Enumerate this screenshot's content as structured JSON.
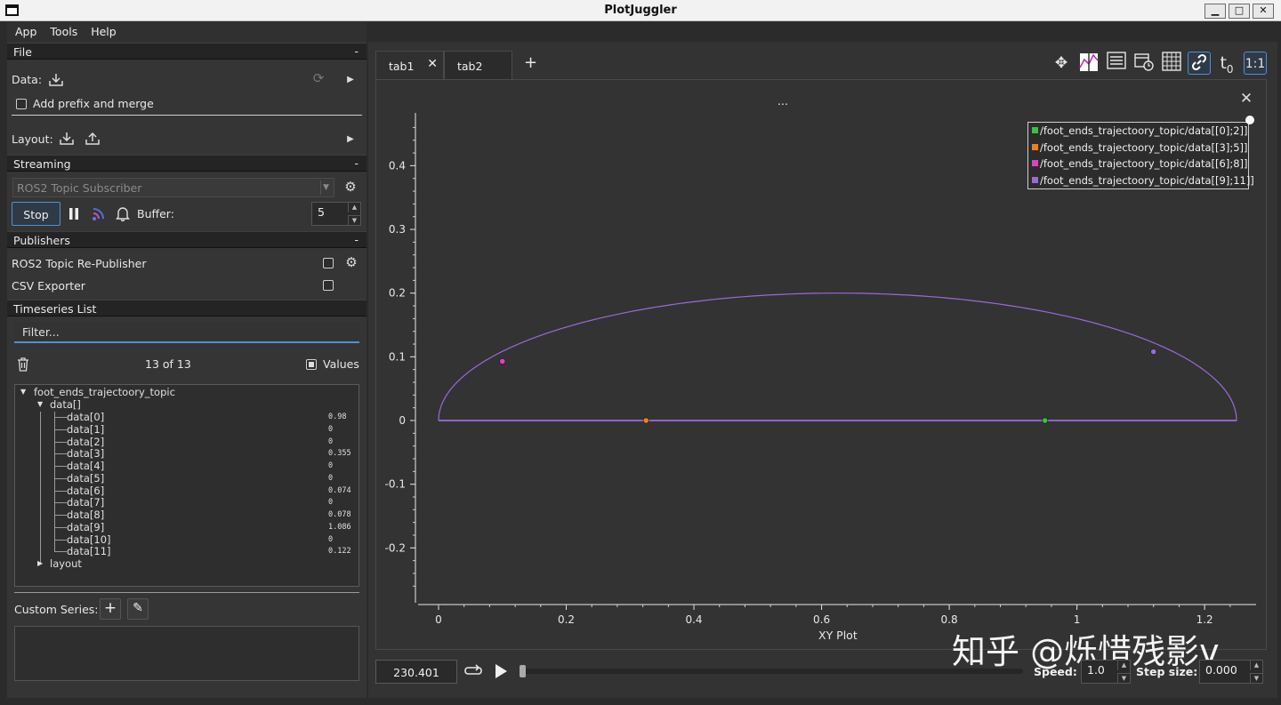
{
  "window": {
    "title": "PlotJuggler",
    "minimize": "▁",
    "maximize": "□",
    "close": "✕"
  },
  "menu": [
    "App",
    "Tools",
    "Help"
  ],
  "file_section": {
    "header": "File",
    "collapse": "-",
    "data_label": "Data:",
    "prefix_merge_label": "Add prefix and merge",
    "layout_label": "Layout:"
  },
  "streaming": {
    "header": "Streaming",
    "collapse": "-",
    "source": "ROS2 Topic Subscriber",
    "stop_label": "Stop",
    "buffer_label": "Buffer:",
    "buffer_value": "5"
  },
  "publishers": {
    "header": "Publishers",
    "collapse": "-",
    "items": [
      {
        "label": "ROS2 Topic Re-Publisher",
        "checked": false
      },
      {
        "label": "CSV Exporter",
        "checked": false
      }
    ]
  },
  "timeseries": {
    "header": "Timeseries List",
    "filter_placeholder": "Filter...",
    "count": "13 of 13",
    "values_label": "Values",
    "tree": {
      "root": "foot_ends_trajectoory_topic",
      "group": "data[]",
      "items": [
        {
          "name": "data[0]",
          "value": "0.98"
        },
        {
          "name": "data[1]",
          "value": "0"
        },
        {
          "name": "data[2]",
          "value": "0"
        },
        {
          "name": "data[3]",
          "value": "0.355"
        },
        {
          "name": "data[4]",
          "value": "0"
        },
        {
          "name": "data[5]",
          "value": "0"
        },
        {
          "name": "data[6]",
          "value": "0.074"
        },
        {
          "name": "data[7]",
          "value": "0"
        },
        {
          "name": "data[8]",
          "value": "0.078"
        },
        {
          "name": "data[9]",
          "value": "1.086"
        },
        {
          "name": "data[10]",
          "value": "0"
        },
        {
          "name": "data[11]",
          "value": "0.122"
        }
      ],
      "layout": "layout"
    }
  },
  "custom_series_label": "Custom Series:",
  "tabs": [
    {
      "label": "tab1",
      "active": true
    },
    {
      "label": "tab2",
      "active": false
    }
  ],
  "add_tab": "+",
  "plot": {
    "top_label": "...",
    "xlabel": "XY Plot",
    "legend": [
      {
        "label": "/foot_ends_trajectoory_topic/data[[0];2]]",
        "color": "#3ec13e"
      },
      {
        "label": "/foot_ends_trajectoory_topic/data[[3];5]]",
        "color": "#f07f1a"
      },
      {
        "label": "/foot_ends_trajectoory_topic/data[[6];8]]",
        "color": "#e040c8"
      },
      {
        "label": "/foot_ends_trajectoory_topic/data[[9];11]]",
        "color": "#9a6ad8"
      }
    ],
    "x_ticks": [
      "0",
      "0.2",
      "0.4",
      "0.6",
      "0.8",
      "1",
      "1.2"
    ],
    "y_ticks": [
      "0.4",
      "0.3",
      "0.2",
      "0.1",
      "0",
      "-0.1",
      "-0.2"
    ],
    "curve_color": "#9a6ad8"
  },
  "chart_data": {
    "type": "line",
    "xlabel": "XY Plot",
    "xlim": [
      -0.03,
      1.28
    ],
    "ylim": [
      -0.28,
      0.48
    ],
    "curve": {
      "shape": "half-ellipse",
      "x_from": 0,
      "x_to": 1.25,
      "peak_y": 0.2
    },
    "points": [
      {
        "series": "/foot_ends_trajectoory_topic/data[[0];2]]",
        "x": 0.95,
        "y": 0.0
      },
      {
        "series": "/foot_ends_trajectoory_topic/data[[3];5]]",
        "x": 0.325,
        "y": 0.0
      },
      {
        "series": "/foot_ends_trajectoory_topic/data[[6];8]]",
        "x": 0.1,
        "y": 0.093
      },
      {
        "series": "/foot_ends_trajectoory_topic/data[[9];11]]",
        "x": 1.12,
        "y": 0.108
      }
    ]
  },
  "player": {
    "time": "230.401",
    "speed_label": "Speed:",
    "speed_value": "1.0",
    "step_label": "Step size:",
    "step_value": "0.000"
  },
  "watermark": "知乎 @烁惜残影v"
}
